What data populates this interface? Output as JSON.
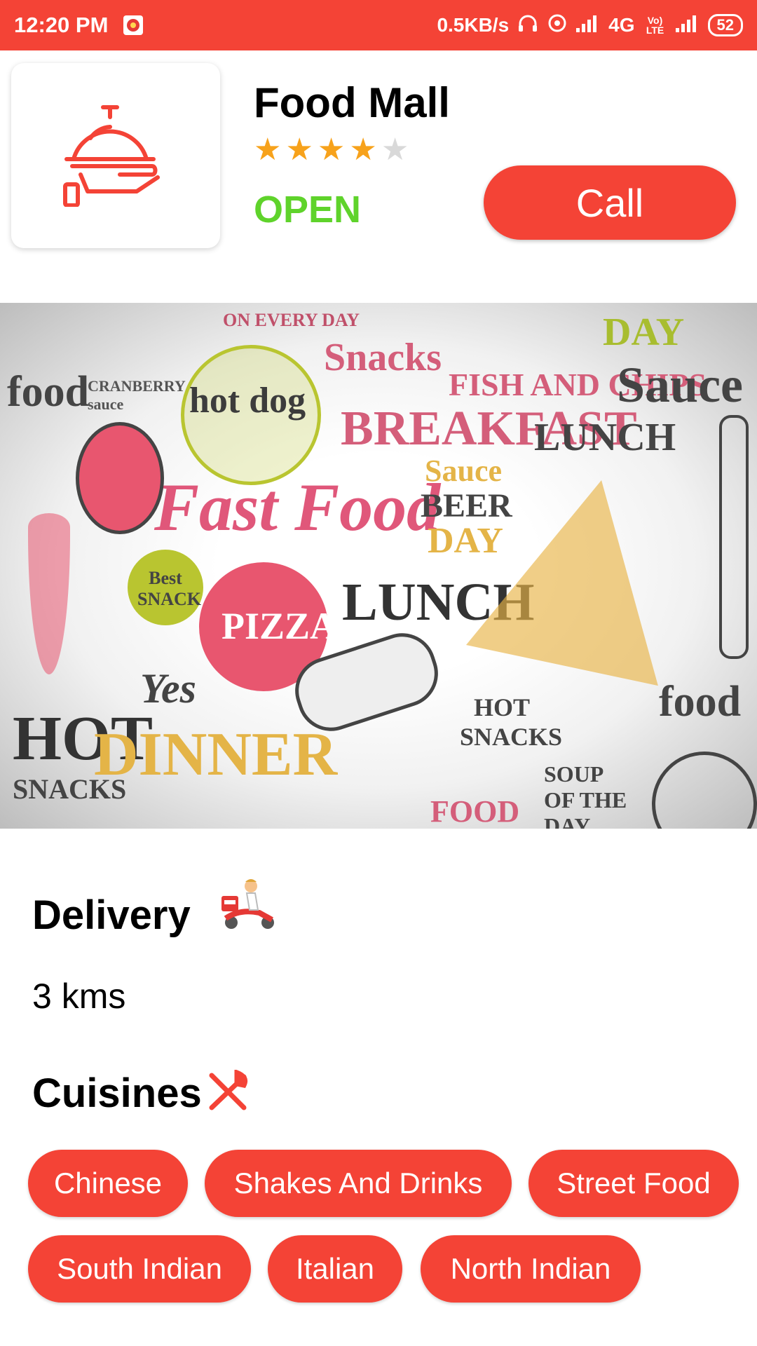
{
  "status_bar": {
    "time": "12:20 PM",
    "network_speed": "0.5KB/s",
    "network_type": "4G",
    "volte": "Vo) LTE",
    "battery": "52"
  },
  "store": {
    "name": "Food Mall",
    "rating": 4,
    "rating_max": 5,
    "status": "OPEN",
    "call_label": "Call",
    "logo_icon": "serving-cloche-icon"
  },
  "banner": {
    "words": [
      "food",
      "hot dog",
      "Snacks",
      "FISH AND CHIPS",
      "Sauce",
      "BREAKFAST",
      "LUNCH",
      "Fast Food",
      "Sauce",
      "BEER",
      "DAY",
      "PIZZA",
      "LUNCH",
      "Best SNACK",
      "Yes",
      "HOT",
      "DINNER",
      "HOT SNACKS",
      "SOUP OF THE DAY",
      "food",
      "CRANBERRY sauce",
      "ON EVERY DAY",
      "DAY",
      "SNACKS",
      "FOOD"
    ]
  },
  "delivery": {
    "title": "Delivery",
    "distance": "3 kms",
    "icon": "delivery-scooter-icon"
  },
  "cuisines": {
    "title": "Cuisines",
    "icon": "fork-knife-icon",
    "items": [
      "Chinese",
      "Shakes And Drinks",
      "Street Food",
      "South Indian",
      "Italian",
      "North Indian"
    ]
  },
  "colors": {
    "primary": "#f44336",
    "open": "#5fd32b",
    "star_filled": "#f7a21b",
    "star_empty": "#d9d9d9"
  }
}
